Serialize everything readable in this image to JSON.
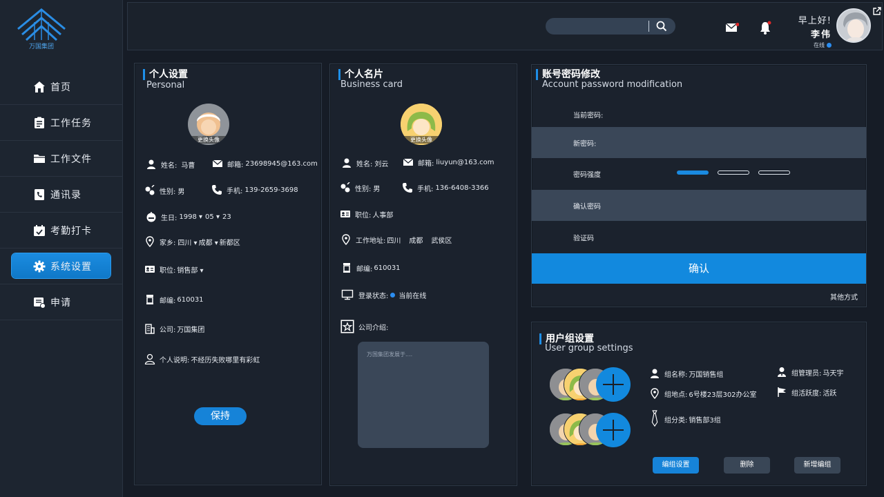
{
  "brand": {
    "name": "万国集团"
  },
  "sidebar": {
    "items": [
      {
        "label": "首页",
        "icon": "home-icon"
      },
      {
        "label": "工作任务",
        "icon": "clipboard-icon"
      },
      {
        "label": "工作文件",
        "icon": "folder-icon"
      },
      {
        "label": "通讯录",
        "icon": "contacts-icon"
      },
      {
        "label": "考勤打卡",
        "icon": "calendar-icon"
      },
      {
        "label": "系统设置",
        "icon": "gear-icon",
        "active": true
      },
      {
        "label": "申请",
        "icon": "application-icon"
      }
    ]
  },
  "header": {
    "search": {
      "placeholder": ""
    },
    "greeting": "早上好!",
    "user_name": "李伟",
    "status": "在线"
  },
  "personal": {
    "title": "个人设置",
    "subtitle": "Personal",
    "avatar_label": "更换头像",
    "name_label": "姓名:",
    "name": "马曹",
    "email_label": "邮箱:",
    "email": "23698945@163.com",
    "gender_label": "性别:",
    "gender": "男",
    "phone_label": "手机:",
    "phone": "139-2659-3698",
    "birthday_label": "生日:",
    "birth_year": "1998",
    "birth_month": "05",
    "birth_day": "23",
    "hometown_label": "家乡:",
    "province": "四川",
    "city": "成都",
    "district": "新都区",
    "position_label": "职位:",
    "position": "销售部",
    "postcode_label": "邮编:",
    "postcode": "610031",
    "company_label": "公司:",
    "company": "万国集团",
    "bio_label": "个人说明:",
    "bio": "不经历失败哪里有彩虹",
    "save_label": "保持"
  },
  "card": {
    "title": "个人名片",
    "subtitle": "Business card",
    "avatar_label": "更换头像",
    "name_label": "姓名:",
    "name": "刘云",
    "email_label": "邮箱:",
    "email": "liuyun@163.com",
    "gender_label": "性别:",
    "gender": "男",
    "phone_label": "手机:",
    "phone": "136-6408-3366",
    "position_label": "职位:",
    "position": "人事部",
    "address_label": "工作地址:",
    "address_province": "四川",
    "address_city": "成都",
    "address_district": "武侯区",
    "postcode_label": "邮编:",
    "postcode": "610031",
    "login_label": "登录状态:",
    "login_status": "当前在线",
    "intro_label": "公司介绍:",
    "intro_placeholder": "万国集团发展于...."
  },
  "password": {
    "title": "账号密码修改",
    "subtitle": "Account password modification",
    "current_label": "当前密码:",
    "new_label": "新密码:",
    "strength_label": "密码强度",
    "strength_level": 1,
    "strength_total": 3,
    "confirm_label": "确认密码",
    "code_label": "验证码",
    "submit_label": "确认",
    "other_label": "其他方式",
    "accent": "#1289de"
  },
  "group": {
    "title": "用户组设置",
    "subtitle": "User group settings",
    "name_label": "组名称:",
    "name": "万国销售组",
    "admin_label": "组管理员:",
    "admin": "马天宇",
    "location_label": "组地点:",
    "location": "6号楼23层302办公室",
    "activity_label": "组活跃度:",
    "activity": "活跃",
    "category_label": "组分类:",
    "category": "销售部3组",
    "btn_edit": "编组设置",
    "btn_delete": "删除",
    "btn_new": "新增编组"
  }
}
